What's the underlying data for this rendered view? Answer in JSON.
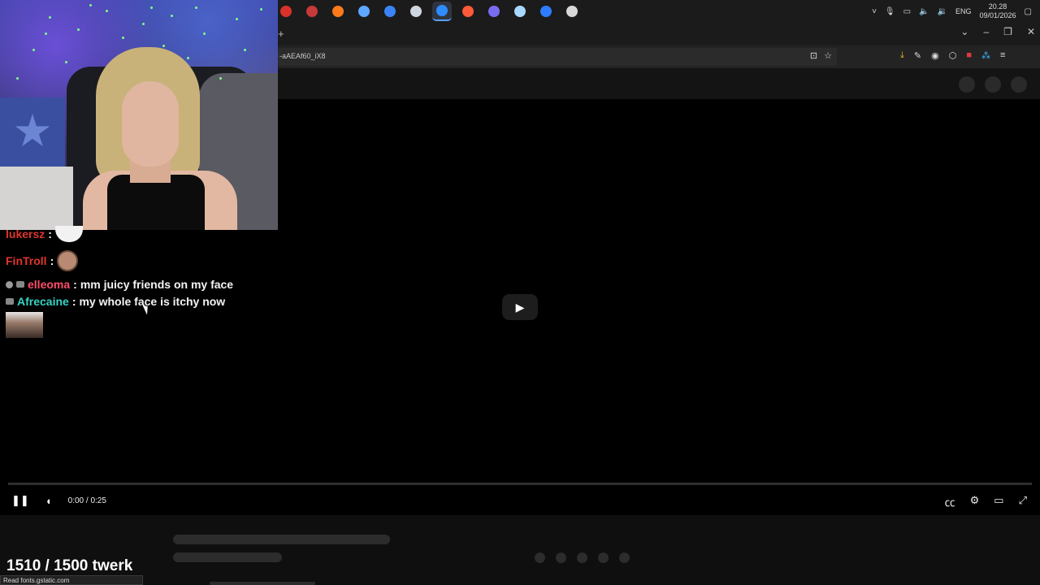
{
  "taskbar": {
    "apps": [
      {
        "icon": "app-red-icon",
        "color": "#d8322a"
      },
      {
        "icon": "speedometer-icon",
        "color": "#c63a3a"
      },
      {
        "icon": "firefox-icon",
        "color": "#ff7a1a"
      },
      {
        "icon": "ccleaner-icon",
        "color": "#5fa8ff"
      },
      {
        "icon": "diamond-app-icon",
        "color": "#3b82f6"
      },
      {
        "icon": "steam-icon",
        "color": "#cfd6de"
      },
      {
        "icon": "firefox-dev-icon",
        "color": "#2f8cff"
      },
      {
        "icon": "firefox-nightly-icon",
        "color": "#ff5a3a"
      },
      {
        "icon": "discord-icon",
        "color": "#7a6cf0"
      },
      {
        "icon": "notepad-icon",
        "color": "#a8d8ff"
      },
      {
        "icon": "firefox-blue-icon",
        "color": "#2f7cff"
      },
      {
        "icon": "shield-app-icon",
        "color": "#d8d8d8"
      }
    ],
    "active_index": 6,
    "tray": {
      "language": "ENG",
      "time": "20.28",
      "date": "09/01/2026"
    }
  },
  "browser": {
    "new_tab_label": "+",
    "url": "-aAEAf60_iX8"
  },
  "chat": {
    "messages": [
      {
        "user": "lukersz",
        "sep": ":"
      },
      {
        "user": "FinTroll",
        "sep": ":"
      },
      {
        "user": "elleoma",
        "sep": ":",
        "text": "mm juicy friends on my face"
      },
      {
        "user": "Afrecaine",
        "sep": ":",
        "text": "my whole face is itchy now"
      }
    ]
  },
  "player": {
    "time": "0:00 / 0:25",
    "progress": 0
  },
  "page": {
    "title": "1510 / 1500 twerk",
    "status": "Read fonts.gstatic.com"
  }
}
